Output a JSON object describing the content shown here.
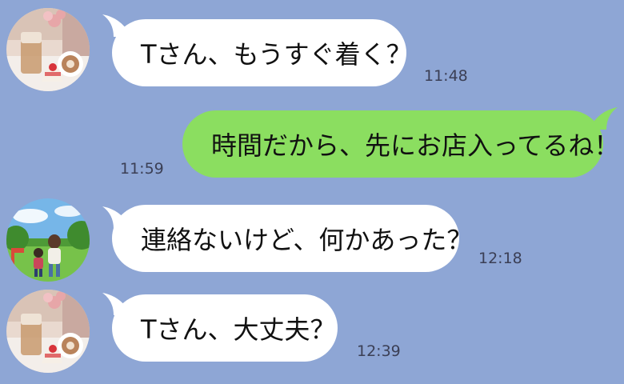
{
  "messages": [
    {
      "sender": "incoming",
      "avatar": "cafe-cake-latte",
      "text": "Tさん、もうすぐ着く？",
      "time": "11:48"
    },
    {
      "sender": "outgoing",
      "text": "時間だから、先にお店入ってるね！",
      "time": "11:59"
    },
    {
      "sender": "incoming",
      "avatar": "mother-child-park",
      "text": "連絡ないけど、何かあった？",
      "time": "12:18"
    },
    {
      "sender": "incoming",
      "avatar": "cafe-cake-latte",
      "text": "Tさん、大丈夫？",
      "time": "12:39"
    }
  ],
  "colors": {
    "background": "#8EA6D5",
    "incoming_bubble": "#FFFFFF",
    "outgoing_bubble": "#8BDE60",
    "timestamp": "#3B3F55"
  }
}
